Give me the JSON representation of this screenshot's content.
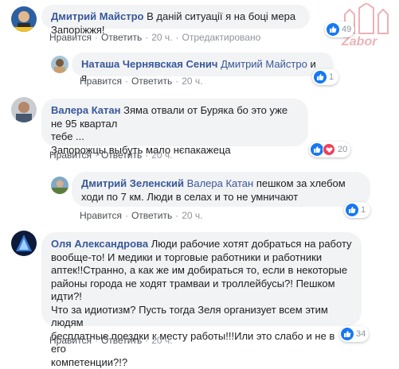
{
  "watermark": {
    "text": "Zabor"
  },
  "comments": [
    {
      "author": "Дмитрий Майстро",
      "text": "В даній ситуації я на боці мера Запоріжжя!",
      "actions": {
        "like": "Нравится",
        "reply": "Ответить",
        "time": "20 ч.",
        "edited": "Отредактировано"
      },
      "reactions": {
        "count": "49",
        "types": [
          "like"
        ]
      }
    },
    {
      "author": "Наташа Чернявская Сенич",
      "mention": "Дмитрий Майстро",
      "text": "и я",
      "actions": {
        "like": "Нравится",
        "reply": "Ответить",
        "time": "20 ч."
      },
      "reactions": {
        "count": "1",
        "types": [
          "like"
        ]
      }
    },
    {
      "author": "Валера Катан",
      "text_line1": "Зяма отвали от Буряка бо это уже не 95 квартал",
      "text_line2": "тебе ...",
      "text_line3": "Запорожцы выбуть мало нєпакажеца",
      "actions": {
        "like": "Нравится",
        "reply": "Ответить",
        "time": "20 ч."
      },
      "reactions": {
        "count": "20",
        "types": [
          "like",
          "love"
        ]
      }
    },
    {
      "author": "Дмитрий Зеленский",
      "mention": "Валера Катан",
      "text_line1": "пешком за хлебом",
      "text_line2": "ходи по 7 км. Люди в селах и то не умничают",
      "actions": {
        "like": "Нравится",
        "reply": "Ответить",
        "time": "20 ч."
      },
      "reactions": {
        "count": "1",
        "types": [
          "like"
        ]
      }
    },
    {
      "author": "Оля Александрова",
      "lines": [
        "Люди рабочие хотят добраться на работу",
        "вообще-то! И медики и торговые работники и работники",
        "аптек!!Странно, а как же им добираться то, если в некоторые",
        "районы города не ходят трамваи и троллейбусы?! Пешком идти?!",
        "Что за идиотизм? Пусть тогда Зеля организует всем этим людям",
        "бесплатные поездки к месту работы!!!Или это слабо и не в его",
        "компетенции?!?"
      ],
      "actions": {
        "like": "Нравится",
        "reply": "Ответить",
        "time": "20 ч."
      },
      "reactions": {
        "count": "34",
        "types": [
          "like"
        ]
      }
    }
  ],
  "colors": {
    "link": "#385898",
    "bubble": "#f2f3f5",
    "like": "#1877f2",
    "love": "#f33e58",
    "meta": "#90949c"
  }
}
